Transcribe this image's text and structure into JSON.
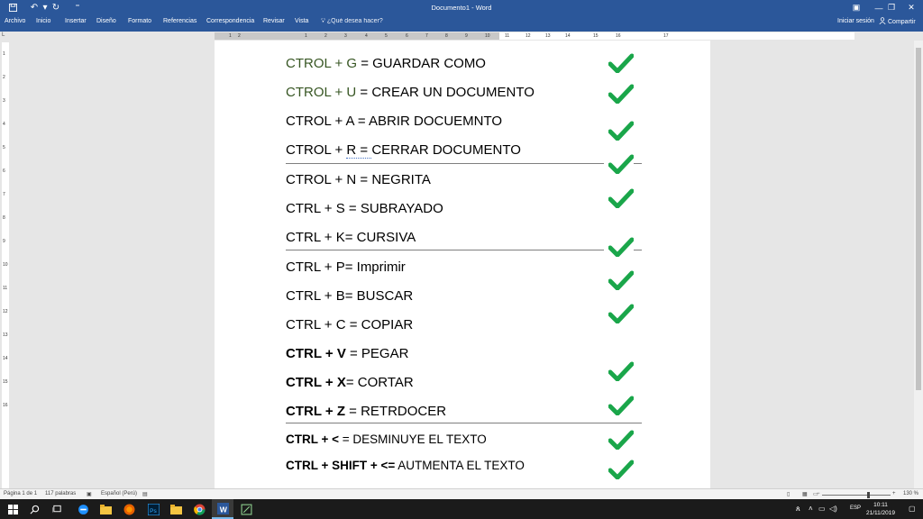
{
  "window": {
    "title": "Documento1 - Word"
  },
  "ribbon": {
    "tabs": [
      "Archivo",
      "Inicio",
      "Insertar",
      "Diseño",
      "Formato",
      "Referencias",
      "Correspondencia",
      "Revisar",
      "Vista"
    ],
    "tell_me": "¿Qué desea hacer?",
    "sign_in": "Iniciar sesión",
    "share": "Compartir"
  },
  "ruler": {
    "numbers": [
      "1",
      "2",
      "1",
      "2",
      "3",
      "4",
      "5",
      "6",
      "7",
      "8",
      "9",
      "10",
      "11",
      "12",
      "13",
      "14",
      "15",
      "16",
      "17"
    ]
  },
  "vruler": {
    "numbers": [
      "1",
      "2",
      "3",
      "4",
      "5",
      "6",
      "7",
      "8",
      "9",
      "10",
      "11",
      "12",
      "13",
      "14",
      "15",
      "16"
    ]
  },
  "document": {
    "lines": [
      {
        "key": "CTROL + G",
        "rest": " = GUARDAR COMO",
        "style": "green"
      },
      {
        "key": "CTROL + U",
        "rest": " = CREAR UN DOCUMENTO",
        "style": "green"
      },
      {
        "key": "CTROL + A",
        "rest": " = ABRIR DOCUEMNTO",
        "style": "plain"
      },
      {
        "key": "CTROL + R ",
        "rest": " = CERRAR DOCUMENTO",
        "style": "plain"
      },
      {
        "key": "CTROL + N",
        "rest": " = NEGRITA",
        "style": "plain"
      },
      {
        "key": "CTRL + S",
        "rest": " = SUBRAYADO",
        "style": "plain"
      },
      {
        "key": "CTRL + K",
        "rest": "= CURSIVA",
        "style": "plain"
      },
      {
        "key": "CTRL + P",
        "rest": "= Imprimir",
        "style": "plain"
      },
      {
        "key": "CTRL + B",
        "rest": "= BUSCAR",
        "style": "plain"
      },
      {
        "key": "CTRL + C",
        "rest": " = COPIAR",
        "style": "plain"
      },
      {
        "key": "CTRL + V",
        "rest": " = PEGAR",
        "style": "bold"
      },
      {
        "key": "CTRL + X",
        "rest": "= CORTAR",
        "style": "bold"
      },
      {
        "key": "CTRL + Z",
        "rest": " = RETRDOCER",
        "style": "bold"
      },
      {
        "key": "CTRL + <",
        "rest": " = DESMINUYE EL TEXTO",
        "style": "bold-small"
      },
      {
        "key": "CTRL + SHIFT + <=",
        "rest": " AUTMENTA EL TEXTO",
        "style": "bold-small"
      }
    ],
    "checkmark_color": "#1aa64a",
    "checkmark_count": 14
  },
  "statusbar": {
    "page": "Página 1 de 1",
    "words": "117 palabras",
    "language": "Español (Perú)",
    "zoom": "130 %",
    "zoom_minus": "−",
    "zoom_plus": "+"
  },
  "taskbar": {
    "lang": "ESP",
    "time": "10:11",
    "date": "21/11/2019"
  },
  "colors": {
    "ribbon": "#2b579a",
    "green_text": "#375623"
  }
}
